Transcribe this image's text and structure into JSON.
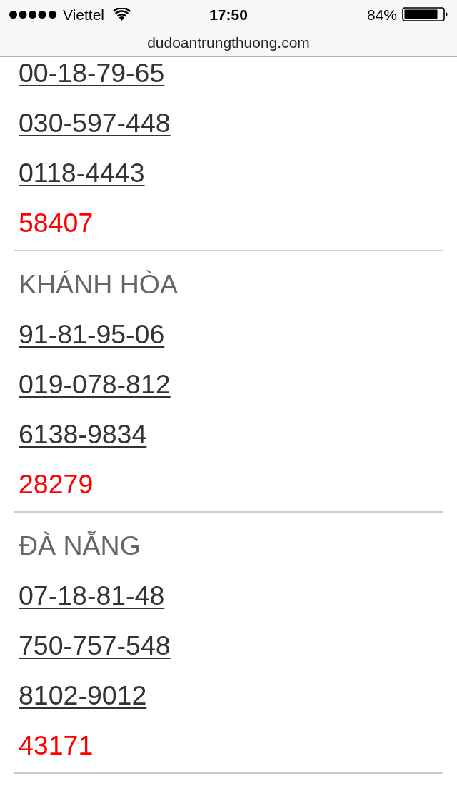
{
  "status_bar": {
    "carrier": "Viettel",
    "time": "17:50",
    "battery": "84%"
  },
  "address_bar": {
    "url": "dudoantrungthuong.com"
  },
  "sections": [
    {
      "items": [
        {
          "kind": "link",
          "text": "00-18-79-65"
        },
        {
          "kind": "link",
          "text": "030-597-448"
        },
        {
          "kind": "link",
          "text": "0118-4443"
        },
        {
          "kind": "prize",
          "text": "58407"
        }
      ]
    },
    {
      "heading": "KHÁNH HÒA",
      "items": [
        {
          "kind": "link",
          "text": "91-81-95-06"
        },
        {
          "kind": "link",
          "text": "019-078-812"
        },
        {
          "kind": "link",
          "text": "6138-9834"
        },
        {
          "kind": "prize",
          "text": "28279"
        }
      ]
    },
    {
      "heading": "ĐÀ NẴNG",
      "items": [
        {
          "kind": "link",
          "text": "07-18-81-48"
        },
        {
          "kind": "link",
          "text": "750-757-548"
        },
        {
          "kind": "link",
          "text": "8102-9012"
        },
        {
          "kind": "prize",
          "text": "43171"
        }
      ]
    }
  ]
}
